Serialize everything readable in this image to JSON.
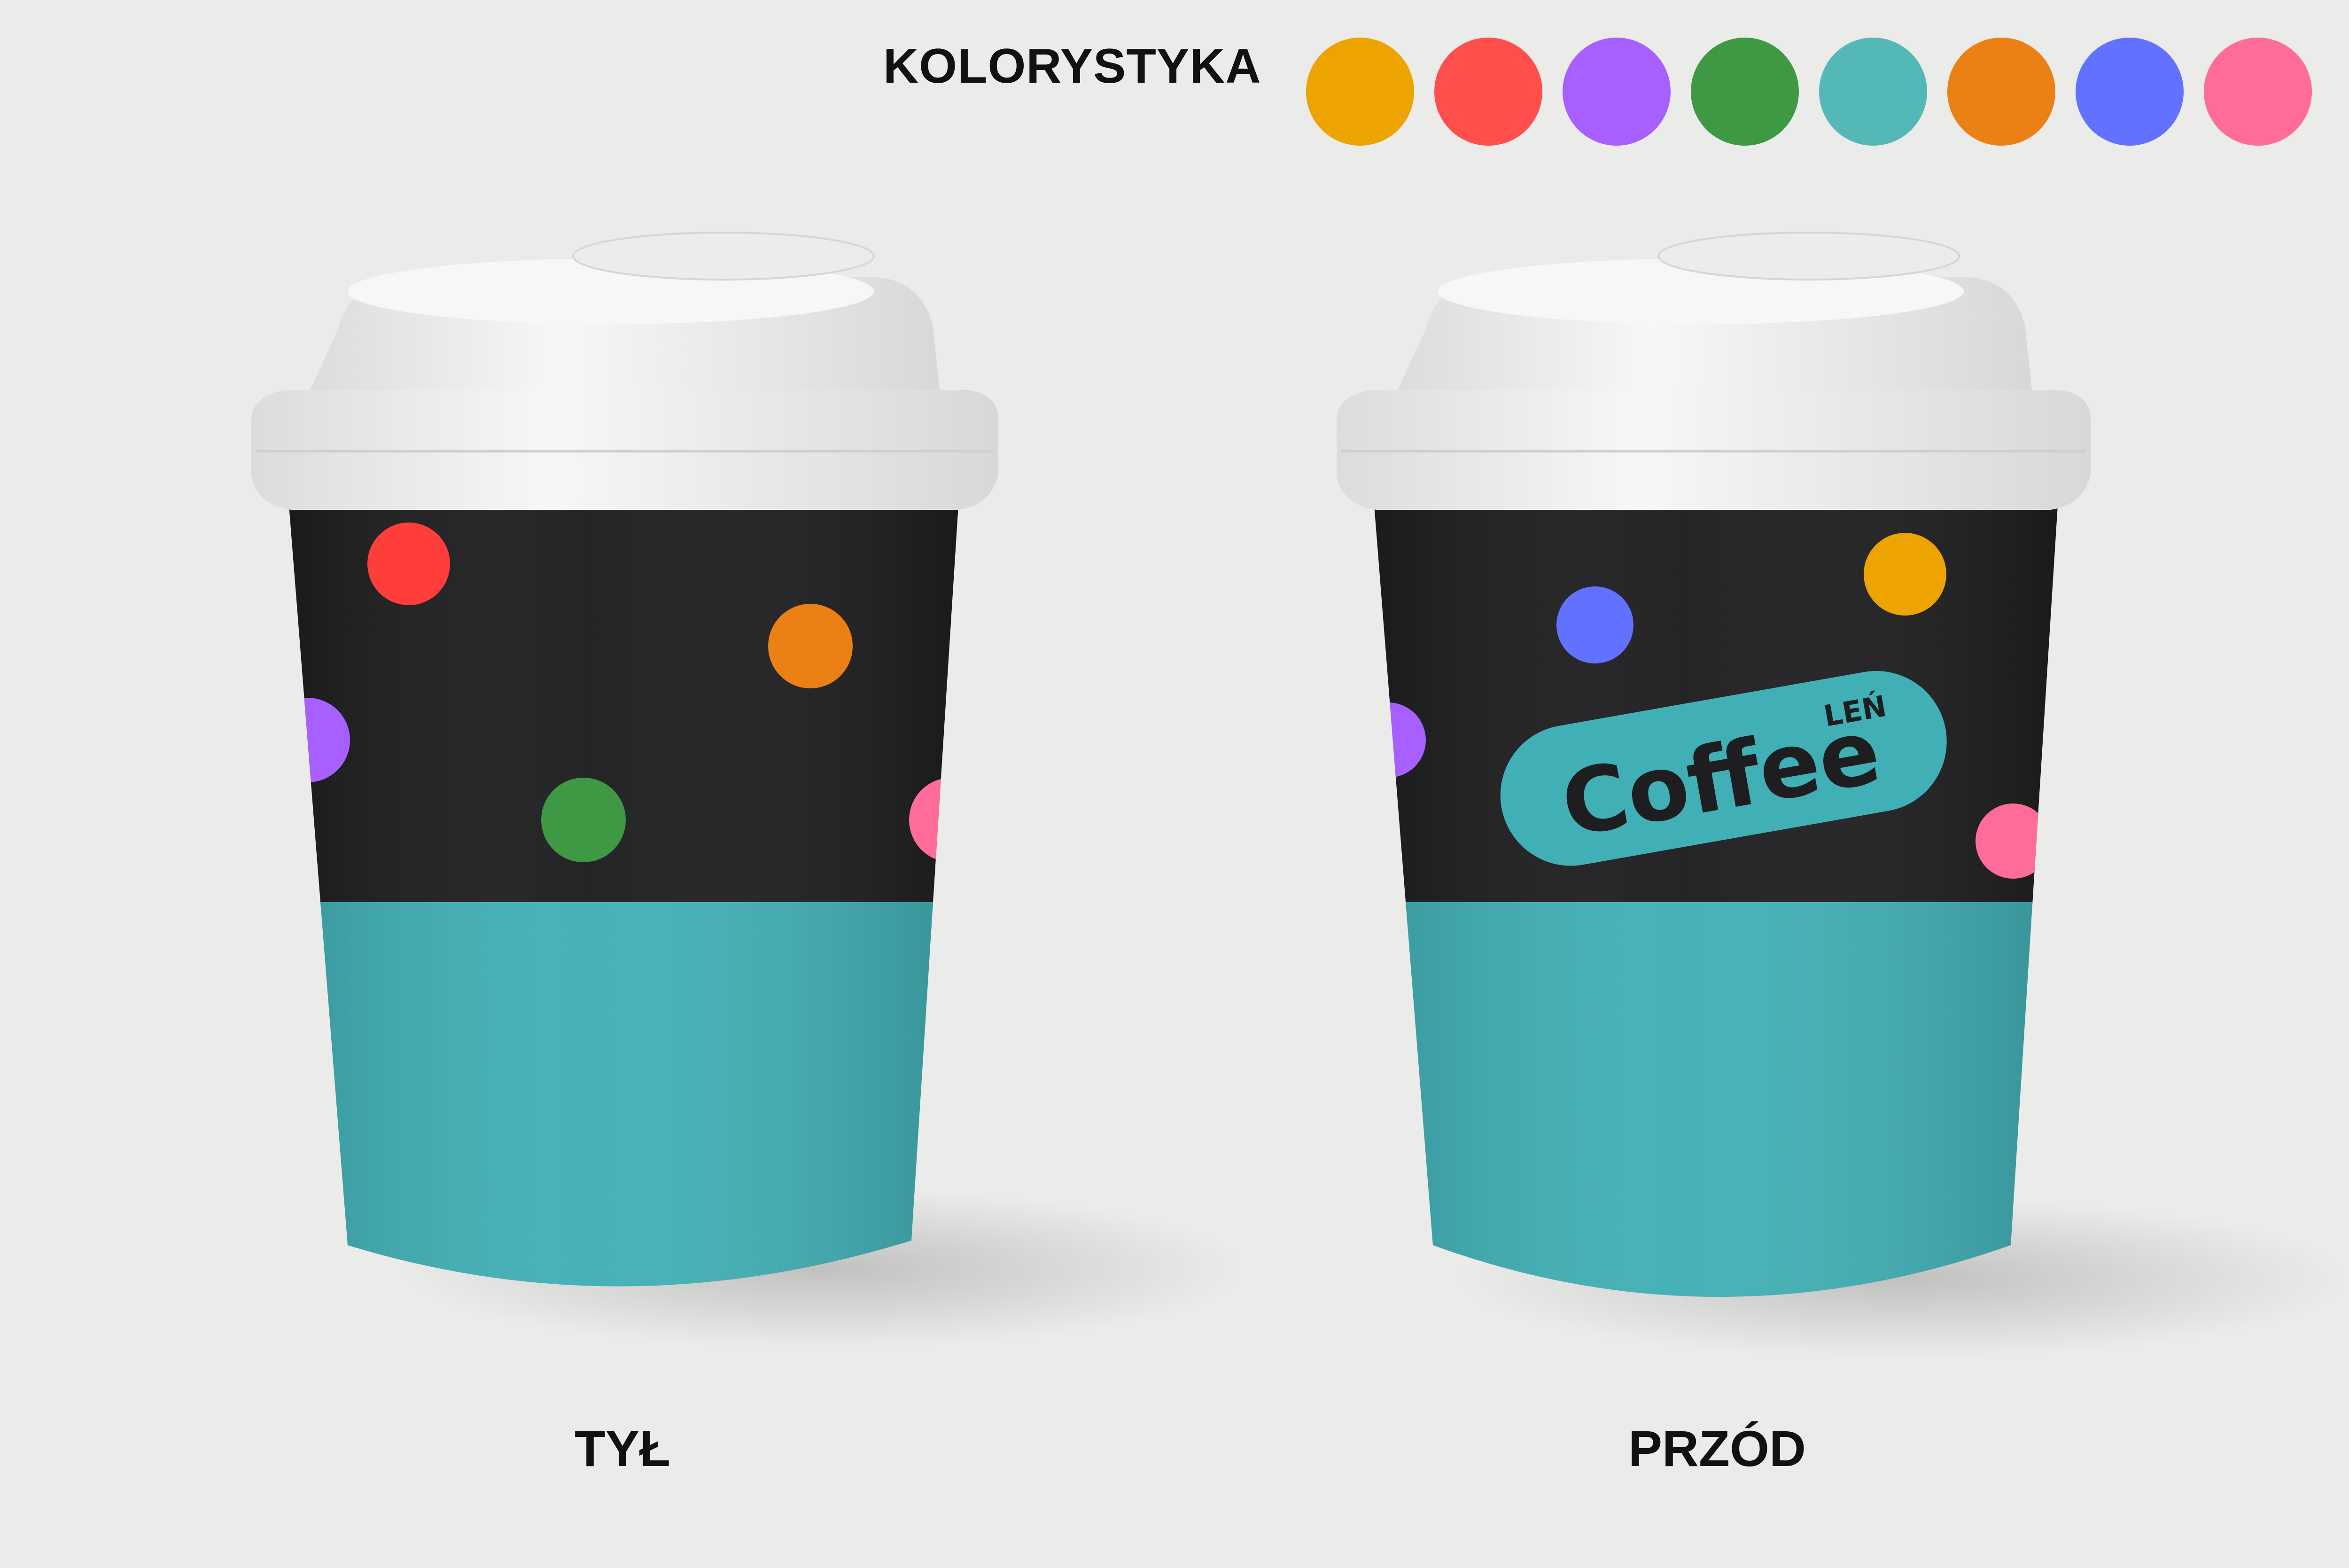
{
  "palette": {
    "title": "KOLORYSTYKA",
    "colors": [
      "#eea400",
      "#ff4e4c",
      "#a760ff",
      "#3e9844",
      "#54b9b6",
      "#eb8115",
      "#6271ff",
      "#ff6c99"
    ]
  },
  "cups": {
    "back_label": "TYŁ",
    "front_label": "PRZÓD",
    "cup_colors": {
      "band": "#1e1e20",
      "base": "#40b0b6",
      "lid": "#f3f3f1"
    }
  },
  "logo": {
    "text": "Coffee",
    "superscript": "LEŃ",
    "badge_color": "#40b0b6"
  }
}
